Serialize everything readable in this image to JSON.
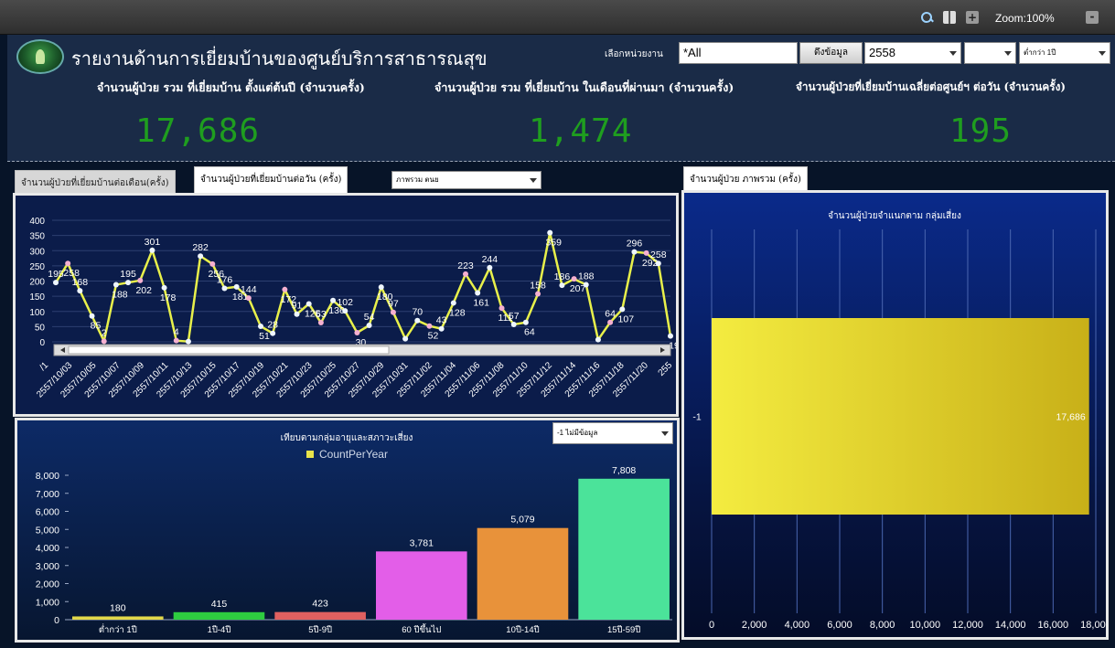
{
  "toolbar": {
    "zoom_label": "Zoom:100%"
  },
  "header": {
    "title": "รายงานด้านการเยี่ยมบ้านของศูนย์บริการสาธารณสุข",
    "unit_label": "เลือกหน่วยงาน",
    "unit_value": "*All",
    "fetch_button": "ดึงข้อมูล",
    "year_value": "2558",
    "month_value": "",
    "age_value": "ต่ำกว่า 1ปี"
  },
  "kpis": [
    {
      "label": "จำนวนผู้ป่วย รวม ที่เยี่ยมบ้าน ตั้งแต่ต้นปี (จำนวนครั้ง)",
      "value": "17,686"
    },
    {
      "label": "จำนวนผู้ป่วย รวม ที่เยี่ยมบ้าน ในเดือนที่ผ่านมา (จำนวนครั้ง)",
      "value": "1,474"
    },
    {
      "label": "จำนวนผู้ป่วยที่เยี่ยมบ้านเฉลี่ยต่อศูนย์ฯ ต่อวัน (จำนวนครั้ง)",
      "value": "195"
    }
  ],
  "tabs": {
    "monthly": "จำนวนผู้ป่วยที่เยี่ยมบ้านต่อเดือน(ครั้ง)",
    "daily": "จำนวนผู้ป่วยที่เยี่ยมบ้านต่อวัน (ครั้ง)",
    "overall": "จำนวนผู้ป่วย ภาพรวม (ครั้ง)"
  },
  "line_filter": "ภาพรวม ตนย",
  "bar_filter": "-1 ไม่มีข้อมูล",
  "colors": {
    "line": "#e8f04a",
    "kpi": "#1f9e1f",
    "bar_legend": "#e8e24a"
  },
  "chart_data": [
    {
      "type": "line",
      "ylim": [
        0,
        400
      ],
      "yticks": [
        0,
        50,
        100,
        150,
        200,
        250,
        300,
        350,
        400
      ],
      "xticks_visible": [
        "/1",
        "2557/10/03",
        "2557/10/05",
        "2557/10/07",
        "2557/10/09",
        "2557/10/11",
        "2557/10/13",
        "2557/10/15",
        "2557/10/17",
        "2557/10/19",
        "2557/10/21",
        "2557/10/23",
        "2557/10/25",
        "2557/10/27",
        "2557/10/29",
        "2557/10/31",
        "2557/11/02",
        "2557/11/04",
        "2557/11/06",
        "2557/11/08",
        "2557/11/10",
        "2557/11/12",
        "2557/11/14",
        "2557/11/16",
        "2557/11/18",
        "2557/11/20",
        "255"
      ],
      "values": [
        195,
        258,
        168,
        85,
        2,
        188,
        195,
        202,
        301,
        178,
        4,
        1,
        282,
        256,
        176,
        181,
        144,
        51,
        28,
        172,
        91,
        125,
        63,
        136,
        102,
        30,
        54,
        180,
        97,
        10,
        70,
        52,
        43,
        128,
        223,
        161,
        244,
        111,
        57,
        64,
        158,
        359,
        186,
        207,
        188,
        7,
        64,
        107,
        296,
        292,
        258,
        19
      ],
      "labels": [
        "195",
        "258",
        "168",
        "85",
        "2",
        "188",
        "195",
        "202",
        "301",
        "178",
        "4",
        "1",
        "282",
        "256",
        "176",
        "181",
        "144",
        "51",
        "28",
        "172",
        "91",
        "125",
        "63",
        "136",
        "102",
        "30",
        "54",
        "180",
        "97",
        "10",
        "70",
        "52",
        "43",
        "128",
        "223",
        "161",
        "244",
        "111",
        "57",
        "64",
        "158",
        "359",
        "186",
        "207",
        "188",
        "7",
        "64",
        "107",
        "296",
        "292",
        "258",
        "19"
      ]
    },
    {
      "type": "bar",
      "title": "เทียบตามกลุ่มอายุและสภาวะเสี่ยง",
      "legend": "CountPerYear",
      "ylim": [
        0,
        8000
      ],
      "yticks": [
        "0",
        "1,000",
        "2,000",
        "3,000",
        "4,000",
        "5,000",
        "6,000",
        "7,000",
        "8,000"
      ],
      "categories": [
        "ต่ำกว่า 1ปี",
        "1ปี-4ปี",
        "5ปี-9ปี",
        "60 ปีขึ้นไป",
        "10ปี-14ปี",
        "15ปี-59ปี"
      ],
      "values": [
        180,
        415,
        423,
        3781,
        5079,
        7808
      ],
      "value_labels": [
        "180",
        "415",
        "423",
        "3,781",
        "5,079",
        "7,808"
      ],
      "colors": [
        "#e2d84a",
        "#2ecc40",
        "#e06060",
        "#e35ee8",
        "#e8923a",
        "#4be39a"
      ]
    },
    {
      "type": "bar",
      "orientation": "horizontal",
      "title": "จำนวนผู้ป่วยจำแนกตาม กลุ่มเสี่ยง",
      "categories": [
        "-1"
      ],
      "values": [
        17686
      ],
      "value_labels": [
        "17,686"
      ],
      "xlim": [
        0,
        18000
      ],
      "xticks": [
        "0",
        "2,000",
        "4,000",
        "6,000",
        "8,000",
        "10,000",
        "12,000",
        "14,000",
        "16,000",
        "18,000"
      ],
      "color": "#e8e02c"
    }
  ]
}
